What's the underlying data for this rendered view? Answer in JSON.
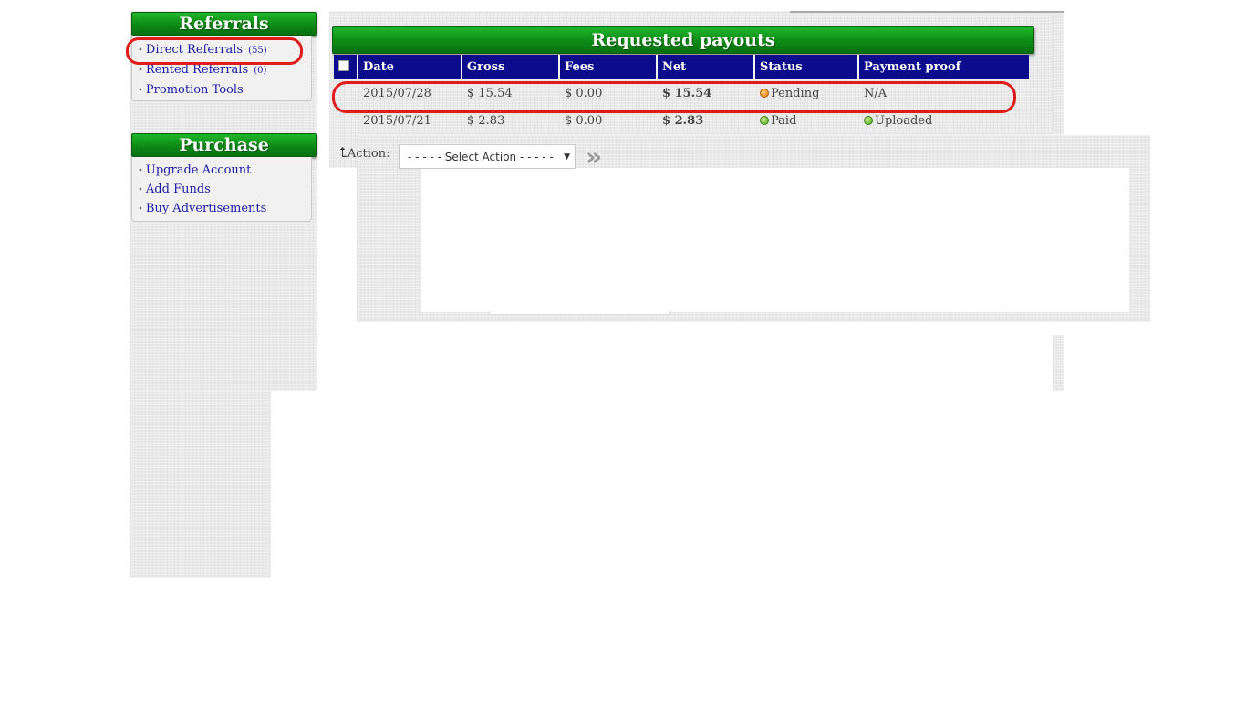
{
  "sidebar": {
    "referrals": {
      "title": "Referrals",
      "items": [
        {
          "label": "Direct Referrals",
          "count": "(55)"
        },
        {
          "label": "Rented Referrals",
          "count": "(0)"
        },
        {
          "label": "Promotion Tools"
        }
      ]
    },
    "purchase": {
      "title": "Purchase",
      "items": [
        {
          "label": "Upgrade Account"
        },
        {
          "label": "Add Funds"
        },
        {
          "label": "Buy Advertisements"
        }
      ]
    }
  },
  "payouts": {
    "title": "Requested payouts",
    "columns": [
      "Date",
      "Gross",
      "Fees",
      "Net",
      "Status",
      "Payment proof"
    ],
    "rows": [
      {
        "date": "2015/07/28",
        "gross": "$ 15.54",
        "fees": "$ 0.00",
        "net": "$ 15.54",
        "status": "Pending",
        "proof": "N/A"
      },
      {
        "date": "2015/07/21",
        "gross": "$ 2.83",
        "fees": "$ 0.00",
        "net": "$ 2.83",
        "status": "Paid",
        "proof": "Uploaded"
      }
    ],
    "action_label": "Action:",
    "action_select": "- - - - - Select Action - - - - -",
    "go_icon": "double-chevron-right-icon"
  },
  "colors": {
    "header_green": "#0d8a16",
    "table_header_blue": "#0b0b8c",
    "link_blue": "#1a1aa6",
    "annotation_red": "#e01b1b"
  }
}
